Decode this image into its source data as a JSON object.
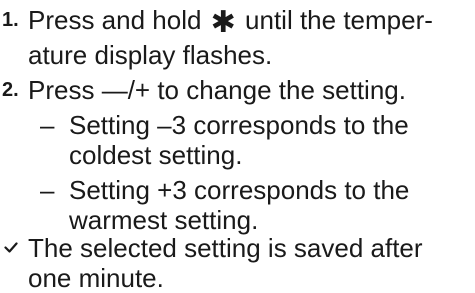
{
  "steps": [
    {
      "number": "1.",
      "line1_before": "Press and hold ",
      "line1_symbol": "✱",
      "line1_after": " until the temper-",
      "line2": "ature display flashes."
    },
    {
      "number": "2.",
      "line1_before": "Press ",
      "line1_symbol": "—/+",
      "line1_after": " to change the setting.",
      "bullets": [
        {
          "dash": "–",
          "line1": "Setting –3 corresponds to the",
          "line2": "coldest setting."
        },
        {
          "dash": "–",
          "line1": "Setting +3 corresponds to the",
          "line2": "warmest setting."
        }
      ]
    }
  ],
  "result": {
    "icon": "check-icon",
    "line1": "The selected setting is saved after",
    "line2": "one minute."
  }
}
